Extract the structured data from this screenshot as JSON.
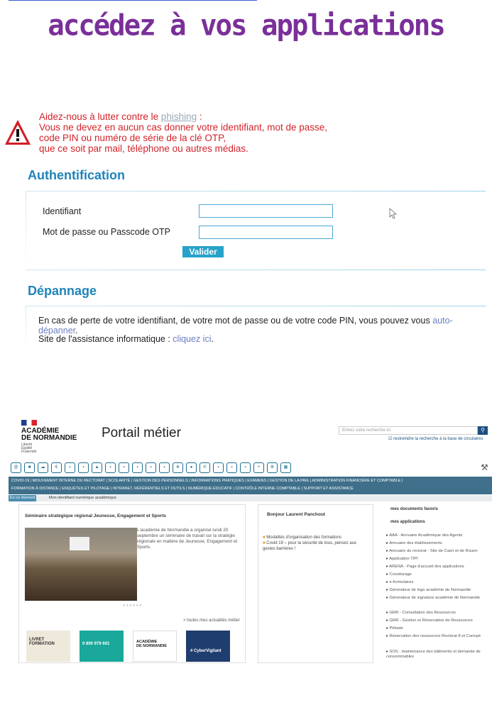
{
  "banner": "accédez à vos applications",
  "warning": {
    "line1_before": "Aidez-nous à lutter contre le ",
    "phishing_word": "phishing",
    "line1_after": " :",
    "line2": "Vous ne devez en aucun cas donner votre identifiant, mot de passe,",
    "line3": "code PIN ou numéro de série de la clé OTP,",
    "line4": "que ce soit par mail, téléphone ou autres médias."
  },
  "auth": {
    "title": "Authentification",
    "username_label": "Identifiant",
    "username_value": "",
    "password_label": "Mot de passe ou Passcode OTP",
    "password_value": "",
    "submit_label": "Valider"
  },
  "help": {
    "title": "Dépannage",
    "line1_text": "En cas de perte de votre identifiant, de votre mot de passe ou de votre code PIN, vous pouvez vous ",
    "line1_link": "auto-dépanner",
    "line1_end": ".",
    "line2_text": "Site de l'assistance informatique : ",
    "line2_link": "cliquez ici",
    "line2_end": "."
  },
  "portal": {
    "academy_line1": "ACADÉMIE",
    "academy_line2": "DE NORMANDIE",
    "motto_line1": "Liberté",
    "motto_line2": "Égalité",
    "motto_line3": "Fraternité",
    "title": "Portail métier",
    "search_placeholder": "Entrez votre recherche ici",
    "restrict_label": "restreindre la recherche à la base de circulaires",
    "menu_line1": "COVID-19 | MOUVEMENT INTERNE DU RECTORAT | SCOLARITÉ | GESTION DES PERSONNELS | INFORMATIONS PRATIQUES | EXAMENS | GESTION DE LA PAIE | ADMINISTRATION FINANCIÈRE ET COMPTABLE |",
    "menu_line2": "FORMATION À DISTANCE | ENQUÊTES ET PILOTAGE | INTRANET, RÉFÉRENTIELS ET OUTILS | NUMÉRIQUE ÉDUCATIF | CONTRÔLE INTERNE COMPTABLE | SUPPORT ET ASSISTANCE",
    "crumb_tag": "En ce moment",
    "crumb_text": "Mon identifiant numérique académique",
    "news_title": "Séminaire stratégique régional Jeunesse, Engagement et Sports",
    "news_text": "L'académie de Normandie a organisé lundi 20 septembre un séminaire de travail sur la stratégie régionale en matière de Jeunesse, Engagement et Sports.",
    "all_news": "> toutes mes actualités métier",
    "tile1_line1": "LIVRET",
    "tile1_line2": "FORMATION",
    "tile2_text": "0 800 979 601",
    "tile3_line1": "ACADÉMIE",
    "tile3_line2": "DE NORMANDIE",
    "tile4_text": "# CyberVigilant",
    "greeting": "Bonjour Laurent Panchout",
    "info1": "Modalités d'organisation des formations",
    "info2": "Covid 19 – pour la sécurité de tous, pensez aux gestes barrières !",
    "fav_head": "mes documents favoris",
    "apps_head": "mes applications",
    "apps": [
      "AAA - Annuaire Académique des Agents",
      "Annuaire des établissements",
      "Annuaire du rectorat - Site de Caen et de Rouen",
      "Application TIPI",
      "ARENA - Page d'accueil des applications",
      "Covoiturage",
      "e-formulaires",
      "Générateur de logo académie de Normandie",
      "Générateur de signature académie de Normandie",
      "GRR - Consultation des Ressources",
      "GRR - Gestion et Réservation de Ressources",
      "Pléiade",
      "Réservation des ressources Rectorat 8 et Canopé",
      "SOS : maintenance des bâtiments et demande de consommables"
    ]
  },
  "colors": {
    "banner": "#7a2f99",
    "warning": "#d2232a",
    "section_title": "#1f84b8",
    "button": "#27a2c9",
    "link": "#6a7fc0",
    "portal_menu": "#3f6f8a"
  }
}
